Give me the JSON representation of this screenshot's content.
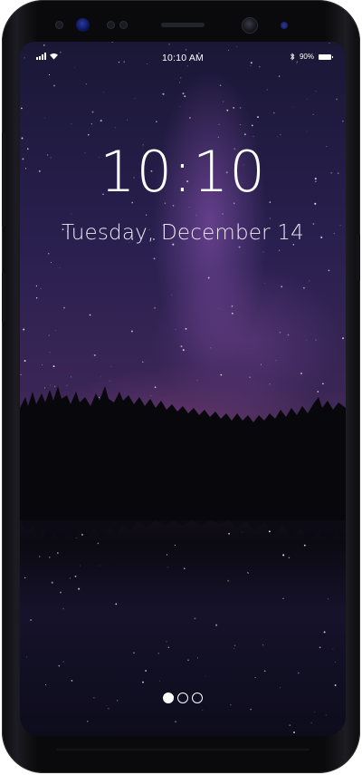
{
  "status_bar": {
    "time": "10:10 AM",
    "battery_text": "90%",
    "battery_level": 0.9,
    "icons": [
      "signal-icon",
      "wifi-icon",
      "bluetooth-icon",
      "battery-icon"
    ]
  },
  "lockscreen": {
    "clock": "10:10",
    "date": "Tuesday, December 14",
    "wallpaper": "milky-way-night-forest-lake"
  },
  "pager": {
    "pages": 3,
    "active_index": 0
  },
  "colors": {
    "text": "#ffffff",
    "sky_purple": "#3a2656",
    "bezel": "#0a0a0c"
  }
}
